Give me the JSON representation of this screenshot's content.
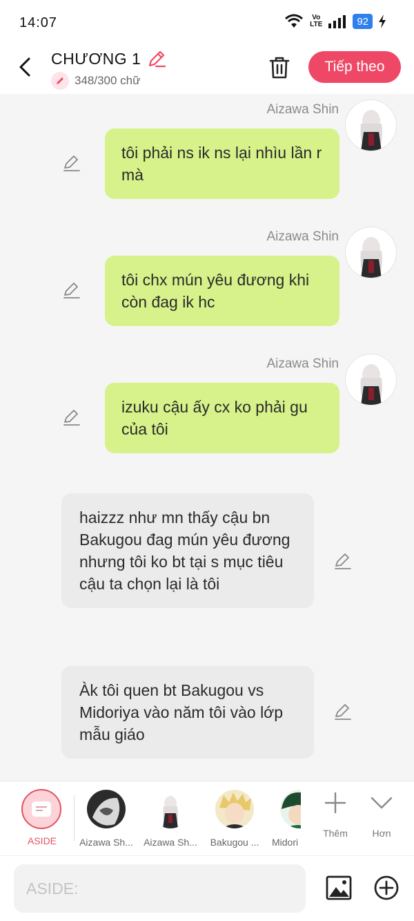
{
  "status_bar": {
    "time": "14:07",
    "network_label": "Vo LTE",
    "battery": "92"
  },
  "header": {
    "title": "CHƯƠNG 1",
    "word_count": "348/300 chữ",
    "next_button": "Tiếp theo"
  },
  "messages": [
    {
      "type": "me",
      "sender": "Aizawa Shin",
      "text": "tôi phải ns ik ns lại nhìu lần r mà"
    },
    {
      "type": "me",
      "sender": "Aizawa Shin",
      "text": "tôi chx mún yêu đương khi còn đag ik hc"
    },
    {
      "type": "me",
      "sender": "Aizawa Shin",
      "text": "izuku cậu ấy cx ko phải gu của tôi"
    },
    {
      "type": "aside",
      "text": "haizzz như mn thấy cậu bn Bakugou đag mún yêu đương nhưng tôi ko bt tại s mục tiêu cậu ta chọn lại là tôi"
    },
    {
      "type": "aside",
      "text": "Àk tôi quen bt Bakugou vs Midoriya vào năm tôi vào lớp mẫu giáo"
    }
  ],
  "character_bar": {
    "aside_label": "ASIDE",
    "characters": [
      {
        "name": "Aizawa Sh..."
      },
      {
        "name": "Aizawa Sh..."
      },
      {
        "name": "Bakugou ..."
      },
      {
        "name": "Midori"
      }
    ],
    "add_label": "Thêm",
    "more_label": "Hơn"
  },
  "input": {
    "placeholder": "ASIDE:"
  },
  "colors": {
    "accent": "#ef4866",
    "my_bubble": "#d7f28a",
    "aside_bubble": "#ebebeb",
    "chat_bg": "#f5f5f5"
  }
}
